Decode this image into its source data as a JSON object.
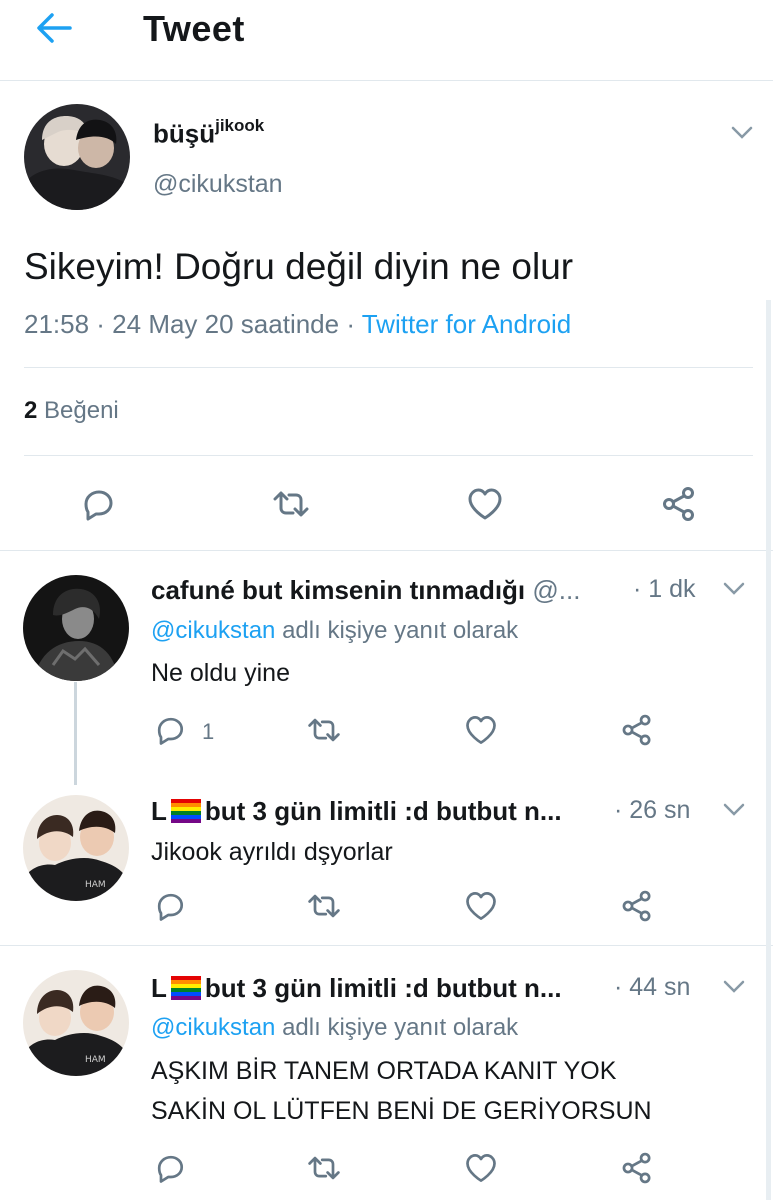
{
  "header": {
    "title": "Tweet"
  },
  "main_tweet": {
    "display_name": "büşü",
    "display_name_sup": "jikook",
    "handle": "@cikukstan",
    "text": "Sikeyim! Doğru değil diyin ne olur",
    "timestamp": "21:58 · 24 May 20 saatinde · ",
    "source": "Twitter for Android",
    "like_count": "2",
    "like_label": " Beğeni"
  },
  "replies": [
    {
      "display_name": "cafuné but kimsenin tınmadığı",
      "handle": " @...",
      "time": "· 1 dk",
      "reply_to": "@cikukstan",
      "reply_suffix": " adlı kişiye yanıt olarak",
      "text": "Ne oldu yine",
      "reply_count": "1"
    },
    {
      "name_prefix": "L",
      "display_name": "but 3 gün limitli :d butbut n...",
      "time": "· 26 sn",
      "text": "Jikook ayrıldı dşyorlar"
    },
    {
      "name_prefix": "L",
      "display_name": "but 3 gün limitli :d butbut n...",
      "time": "· 44 sn",
      "reply_to": "@cikukstan",
      "reply_suffix": " adlı kişiye yanıt olarak",
      "text_line1": "AŞKIM BİR TANEM ORTADA KANIT YOK",
      "text_line2": "SAKİN OL LÜTFEN BENİ DE GERİYORSUN"
    }
  ],
  "icons": {
    "back": "arrow-left-icon",
    "reply": "speech-bubble-icon",
    "retweet": "retweet-icon",
    "like": "heart-icon",
    "share": "share-icon",
    "more": "chevron-down-icon",
    "flag": "rainbow-flag-icon"
  },
  "colors": {
    "accent": "#1da1f2",
    "secondary_text": "#657786",
    "primary_text": "#14171a",
    "divider": "#e1e8ed"
  }
}
